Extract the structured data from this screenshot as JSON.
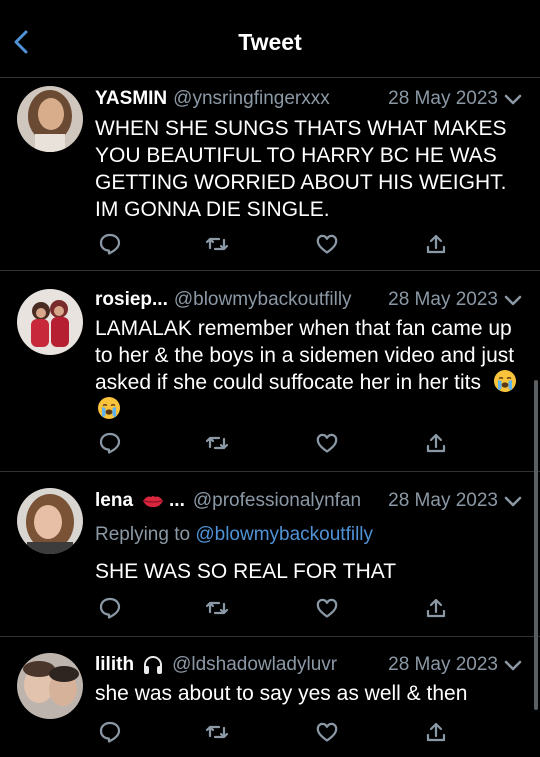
{
  "header": {
    "title": "Tweet",
    "back_icon": "chevron-left-icon"
  },
  "colors": {
    "background": "#000000",
    "text": "#ffffff",
    "secondary_text": "#8b98a5",
    "accent": "#4f93d6",
    "divider": "#2f3336"
  },
  "tweets": [
    {
      "name": "YASMIN",
      "handle": "@ynsringfingerxxx",
      "date": "28 May 2023",
      "text": "WHEN SHE SUNGS THATS WHAT MAKES YOU BEAUTIFUL TO HARRY BC HE WAS GETTING WORRIED ABOUT HIS WEIGHT. IM GONNA DIE SINGLE."
    },
    {
      "name": "rosiep...",
      "handle": "@blowmybackoutfilly",
      "date": "28 May 2023",
      "text": "LAMALAK remember when that fan came up to her & the boys in a sidemen video and just asked if she could suffocate her in her tits",
      "emoji": [
        "loudly-crying-face",
        "loudly-crying-face"
      ]
    },
    {
      "name": "lena",
      "name_emoji": "lips-kiss-icon",
      "name_suffix": "...",
      "handle": "@professionalynfan",
      "date": "28 May 2023",
      "reply_prefix": "Replying to",
      "reply_handle": "@blowmybackoutfilly",
      "text": "SHE WAS SO REAL FOR THAT"
    },
    {
      "name": "lilith",
      "name_emoji": "headphones-icon",
      "handle": "@ldshadowladyluvr",
      "date": "28 May 2023",
      "text": "she was about to say yes as well & then"
    }
  ],
  "actions": [
    "reply-icon",
    "retweet-icon",
    "like-icon",
    "share-icon"
  ]
}
